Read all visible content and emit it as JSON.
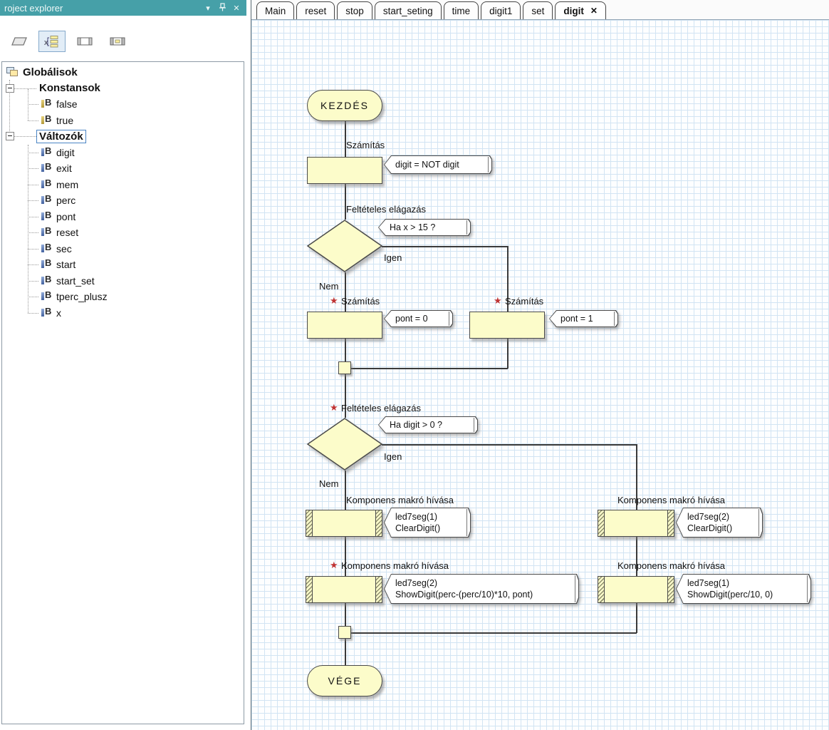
{
  "explorer": {
    "title": "roject explorer",
    "menu_icon": "▾",
    "close_icon": "✕",
    "tree": {
      "root": "Globálisok",
      "groups": [
        {
          "label": "Konstansok",
          "items": [
            "false",
            "true"
          ]
        },
        {
          "label": "Változók",
          "items": [
            "digit",
            "exit",
            "mem",
            "perc",
            "pont",
            "reset",
            "sec",
            "start",
            "start_set",
            "tperc_plusz",
            "x"
          ]
        }
      ]
    }
  },
  "tabs": [
    {
      "label": "Main"
    },
    {
      "label": "reset"
    },
    {
      "label": "stop"
    },
    {
      "label": "start_seting"
    },
    {
      "label": "time"
    },
    {
      "label": "digit1"
    },
    {
      "label": "set"
    },
    {
      "label": "digit",
      "close": "✕"
    }
  ],
  "flow": {
    "breakpoint": "★",
    "start": "KEZDÉS",
    "end": "VÉGE",
    "yes": "Igen",
    "no": "Nem",
    "calc_title": "Számítás",
    "decision_title": "Feltételes elágazás",
    "macro_title": "Komponens makró hívása",
    "notes": {
      "calc1": "digit = NOT digit",
      "dec1": "Ha x > 15 ?",
      "calc2": "pont = 0",
      "calc3": "pont = 1",
      "dec2": "Ha digit > 0 ?",
      "macro1a": "led7seg(1)",
      "macro1b": "ClearDigit()",
      "macro2a": "led7seg(2)",
      "macro2b": "ClearDigit()",
      "macro3a": "led7seg(2)",
      "macro3b": "ShowDigit(perc-(perc/10)*10, pont)",
      "macro4a": "led7seg(1)",
      "macro4b": "ShowDigit(perc/10, 0)"
    }
  },
  "colors": {
    "titlebar": "#46a0a8",
    "shape_fill": "#fcfcca",
    "grid_line": "#d2e4f3",
    "breakpoint": "#c03333"
  }
}
